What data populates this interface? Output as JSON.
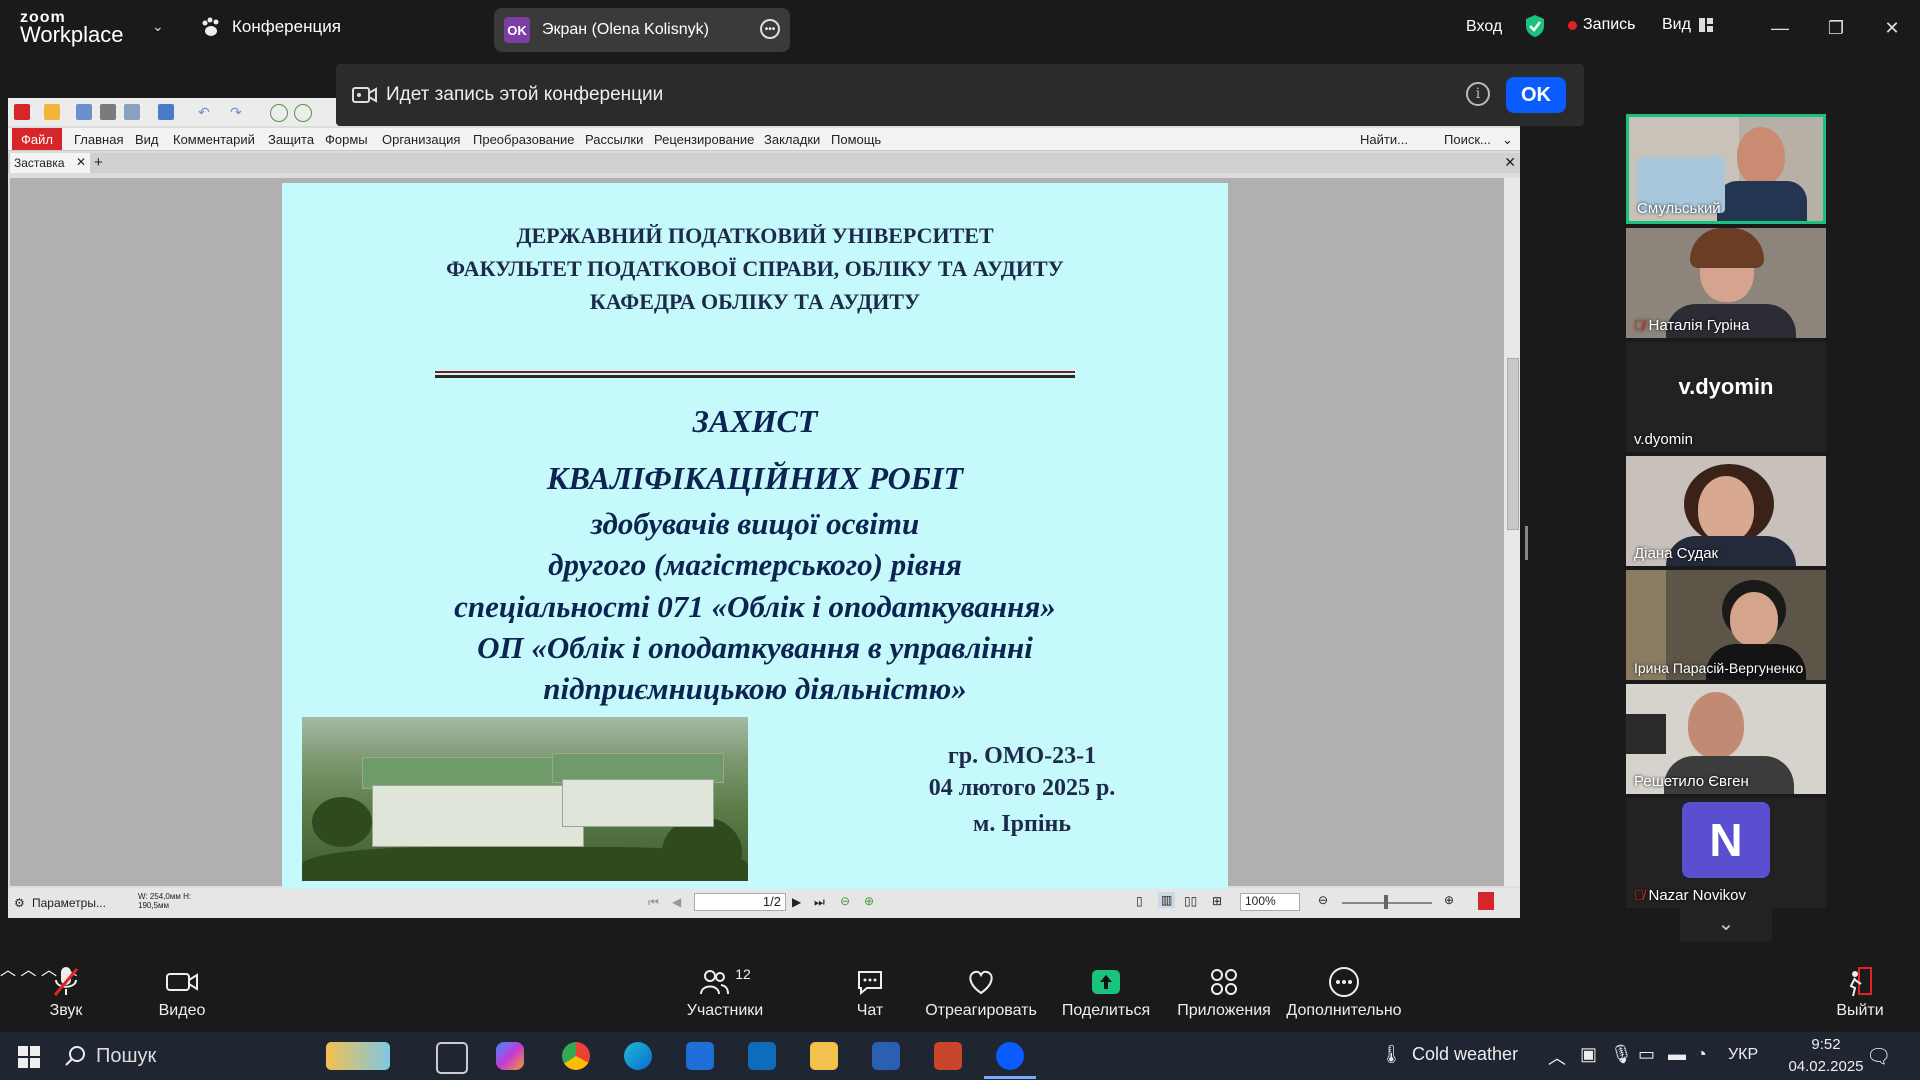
{
  "topbar": {
    "logo_top": "zoom",
    "logo_bottom": "Workplace",
    "meeting_label": "Конференция",
    "screen_share_initials": "OK",
    "screen_share_label": "Экран (Olena Kolisnyk)",
    "login_label": "Вход",
    "record_label": "Запись",
    "view_label": "Вид"
  },
  "recording_banner": {
    "text": "Идет запись этой конференции",
    "ok_label": "OK"
  },
  "pdf_app": {
    "menu": [
      "Файл",
      "Главная",
      "Вид",
      "Комментарий",
      "Защита",
      "Формы",
      "Организация",
      "Преобразование",
      "Рассылки",
      "Рецензирование",
      "Закладки",
      "Помощь"
    ],
    "find_label": "Найти...",
    "search_label": "Поиск...",
    "tab_name": "Заставка",
    "status_params": "Параметры...",
    "status_dims": "W: 254,0мм H: 190,5мм",
    "page_indicator": "1/2",
    "zoom_value": "100%"
  },
  "slide": {
    "header1": "ДЕРЖАВНИЙ ПОДАТКОВИЙ УНІВЕРСИТЕТ",
    "header2": "ФАКУЛЬТЕТ ПОДАТКОВОЇ СПРАВИ, ОБЛІКУ ТА АУДИТУ",
    "header3": "КАФЕДРА ОБЛІКУ ТА АУДИТУ",
    "title1": "ЗАХИСТ",
    "title2": "КВАЛІФІКАЦІЙНИХ РОБІТ",
    "line1": "здобувачів вищої освіти",
    "line2": "другого (магістерського) рівня",
    "line3": "спеціальності 071 «Облік і оподаткування»",
    "line4": "ОП «Облік і оподаткування в управлінні",
    "line5": "підприємницькою діяльністю»",
    "group": "гр. ОМО-23-1",
    "date": "04 лютого 2025 р.",
    "city": "м. Ірпінь"
  },
  "participants": [
    {
      "name": "Смульський",
      "muted": false
    },
    {
      "name": "Наталія Гуріна",
      "muted": true
    },
    {
      "name": "v.dyomin",
      "display": "v.dyomin",
      "muted": false
    },
    {
      "name": "Діана Судак",
      "muted": false
    },
    {
      "name": "Ірина Парасій-Вергуненко",
      "muted": false
    },
    {
      "name": "Решетило Євген",
      "muted": false
    },
    {
      "name": "Nazar Novikov",
      "initial": "N",
      "muted": true
    }
  ],
  "toolbar": {
    "audio": "Звук",
    "video": "Видео",
    "participants": "Участники",
    "participants_count": "12",
    "chat": "Чат",
    "react": "Отреагировать",
    "share": "Поделиться",
    "apps": "Приложения",
    "more": "Дополнительно",
    "leave": "Выйти"
  },
  "taskbar": {
    "search_label": "Пошук",
    "weather": "Cold weather",
    "lang": "УКР",
    "time": "9:52",
    "date": "04.02.2025"
  },
  "colors": {
    "zoom_blue": "#0b5cff",
    "record_red": "#e02424",
    "share_green": "#19c37d",
    "slide_bg": "#c6f9fb"
  }
}
